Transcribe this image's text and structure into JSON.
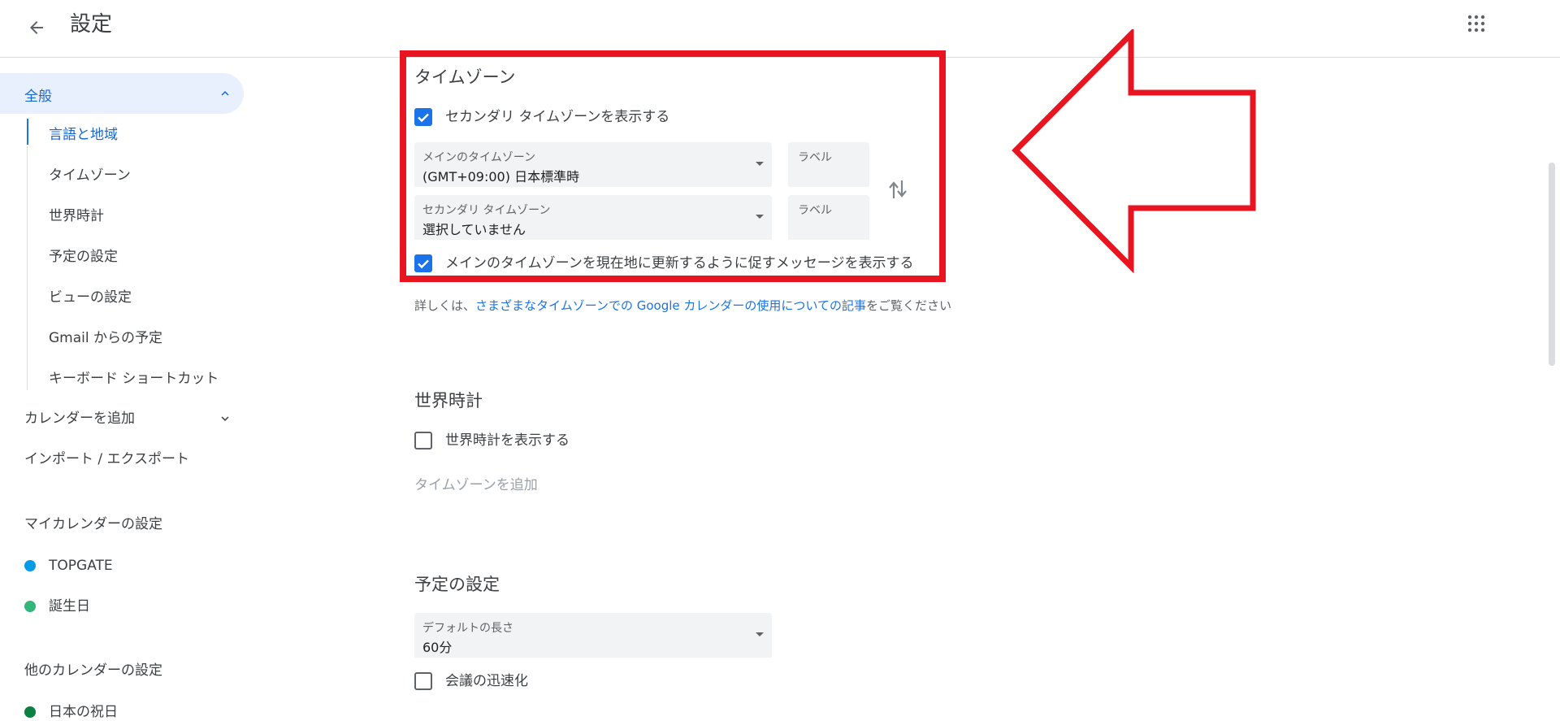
{
  "header": {
    "title": "設定"
  },
  "sidebar": {
    "general": "全般",
    "sub_items": [
      "言語と地域",
      "タイムゾーン",
      "世界時計",
      "予定の設定",
      "ビューの設定",
      "Gmail からの予定",
      "キーボード ショートカット"
    ],
    "add_calendar": "カレンダーを追加",
    "import_export": "インポート / エクスポート",
    "my_calendars_heading": "マイカレンダーの設定",
    "my_calendars": [
      {
        "name": "TOPGATE",
        "color": "#039be5"
      },
      {
        "name": "誕生日",
        "color": "#33b679"
      }
    ],
    "other_calendars_heading": "他のカレンダーの設定",
    "other_calendars": [
      {
        "name": "日本の祝日",
        "color": "#0b8043"
      }
    ]
  },
  "timezone": {
    "title": "タイムゾーン",
    "show_secondary_label": "セカンダリ タイムゾーンを表示する",
    "show_secondary_checked": true,
    "primary": {
      "label": "メインのタイムゾーン",
      "value": "(GMT+09:00) 日本標準時"
    },
    "secondary": {
      "label": "セカンダリ タイムゾーン",
      "value": "選択していません"
    },
    "label_placeholder_1": "ラベル",
    "label_placeholder_2": "ラベル",
    "prompt_update_label": "メインのタイムゾーンを現在地に更新するように促すメッセージを表示する",
    "prompt_update_checked": true,
    "info_prefix": "詳しくは、",
    "info_link": "さまざまなタイムゾーンでの Google カレンダーの使用についての記事",
    "info_suffix": "をご覧ください"
  },
  "world_clock": {
    "title": "世界時計",
    "show_label": "世界時計を表示する",
    "show_checked": false,
    "add_timezone": "タイムゾーンを追加"
  },
  "event_settings": {
    "title": "予定の設定",
    "duration": {
      "label": "デフォルトの長さ",
      "value": "60分"
    },
    "speedy_meetings_label": "会議の迅速化",
    "speedy_meetings_checked": false
  },
  "colors": {
    "accent": "#1a73e8",
    "highlight": "#e8141f"
  },
  "icons": {
    "back": "arrow-left-icon",
    "apps": "grid-icon",
    "swap": "swap-vertical-icon",
    "expand": "chevron-up-icon",
    "collapse": "chevron-down-icon"
  }
}
